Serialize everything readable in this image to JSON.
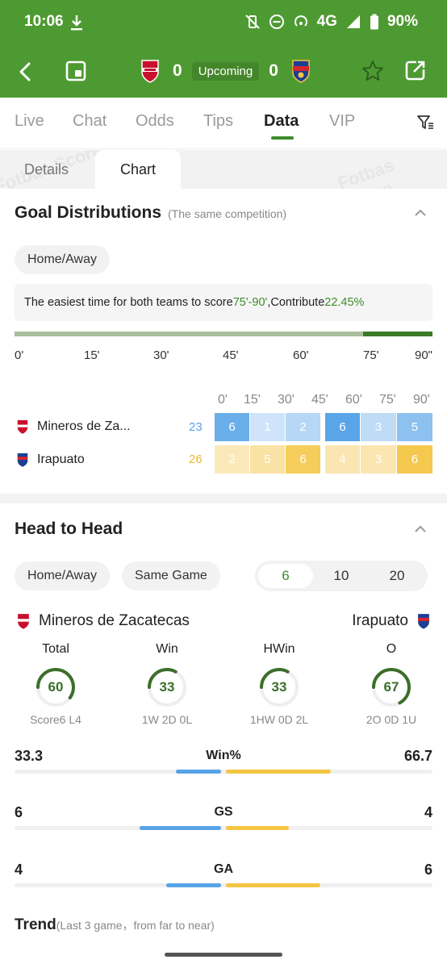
{
  "status_bar": {
    "time": "10:06",
    "network": "4G",
    "battery": "90%"
  },
  "match": {
    "home_score": "0",
    "status": "Upcoming",
    "away_score": "0"
  },
  "tabs": [
    {
      "label": "Live"
    },
    {
      "label": "Chat"
    },
    {
      "label": "Odds"
    },
    {
      "label": "Tips"
    },
    {
      "label": "Data"
    },
    {
      "label": "VIP"
    }
  ],
  "subtabs": [
    {
      "label": "Details"
    },
    {
      "label": "Chart"
    }
  ],
  "watermark": "Fotbas Score",
  "goal_distribution": {
    "title": "Goal Distributions",
    "subtitle": "(The same competition)",
    "filter_label": "Home/Away",
    "info_prefix": "The easiest time for both teams to score",
    "info_time": "75'-90'",
    "info_mid": ",Contribute",
    "info_pct": "22.45%",
    "highlight_fraction": 0.1667,
    "ticks": [
      "0'",
      "15'",
      "30'",
      "45'",
      "60'",
      "75'",
      "90\""
    ],
    "grid_headers": [
      "0'",
      "15'",
      "30'",
      "45'",
      "60'",
      "75'",
      "90'"
    ],
    "teams": [
      {
        "name": "Mineros de Za...",
        "total": "23",
        "values": [
          "6",
          "1",
          "2",
          "6",
          "3",
          "5"
        ]
      },
      {
        "name": "Irapuato",
        "total": "26",
        "values": [
          "2",
          "5",
          "6",
          "4",
          "3",
          "6"
        ]
      }
    ]
  },
  "head_to_head": {
    "title": "Head to Head",
    "filter_home_away": "Home/Away",
    "filter_same_game": "Same Game",
    "game_counts": [
      "6",
      "10",
      "20"
    ],
    "home_team": "Mineros de Zacatecas",
    "away_team": "Irapuato",
    "stats": [
      {
        "label": "Total",
        "value": "60",
        "pct": 60,
        "sub": "Score6 L4"
      },
      {
        "label": "Win",
        "value": "33",
        "pct": 33,
        "sub": "1W 2D 0L"
      },
      {
        "label": "HWin",
        "value": "33",
        "pct": 33,
        "sub": "1HW 0D 2L"
      },
      {
        "label": "O",
        "value": "67",
        "pct": 67,
        "sub": "2O 0D 1U"
      }
    ],
    "comparisons": [
      {
        "label": "Win%",
        "left": "33.3",
        "right": "66.7",
        "lfrac": 0.333,
        "rfrac": 0.667
      },
      {
        "label": "GS",
        "left": "6",
        "right": "4",
        "lfrac": 0.6,
        "rfrac": 0.4
      },
      {
        "label": "GA",
        "left": "4",
        "right": "6",
        "lfrac": 0.4,
        "rfrac": 0.6
      }
    ],
    "trend_title": "Trend",
    "trend_sub": "(Last 3 game，from far to near)"
  },
  "colors": {
    "brand_green": "#4e9a32",
    "home_blue": "#58a3e6",
    "away_yellow": "#f4c542",
    "ring_green": "#3b6f2a"
  }
}
